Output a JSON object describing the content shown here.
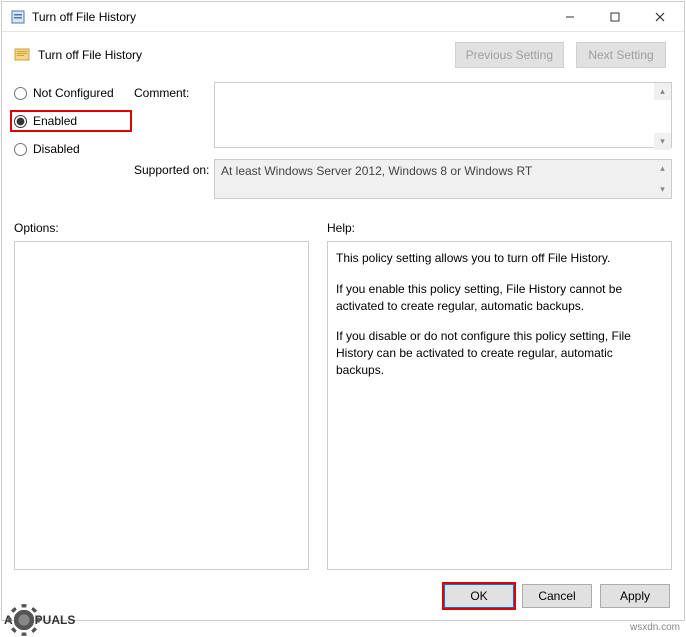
{
  "window": {
    "title": "Turn off File History"
  },
  "header": {
    "title": "Turn off File History",
    "prev_label": "Previous Setting",
    "next_label": "Next Setting"
  },
  "radios": {
    "not_configured": "Not Configured",
    "enabled": "Enabled",
    "disabled": "Disabled",
    "selected": "enabled"
  },
  "fields": {
    "comment_label": "Comment:",
    "comment_value": "",
    "supported_label": "Supported on:",
    "supported_value": "At least Windows Server 2012, Windows 8 or Windows RT"
  },
  "panels": {
    "options_label": "Options:",
    "help_label": "Help:",
    "help_paragraphs": [
      "This policy setting allows you to turn off File History.",
      "If you enable this policy setting, File History cannot be activated to create regular, automatic backups.",
      "If you disable or do not configure this policy setting, File History can be activated to create regular, automatic backups."
    ]
  },
  "footer": {
    "ok": "OK",
    "cancel": "Cancel",
    "apply": "Apply"
  },
  "watermark": "wsxdn.com",
  "logo": {
    "pre": "A",
    "post": "PUALS"
  }
}
